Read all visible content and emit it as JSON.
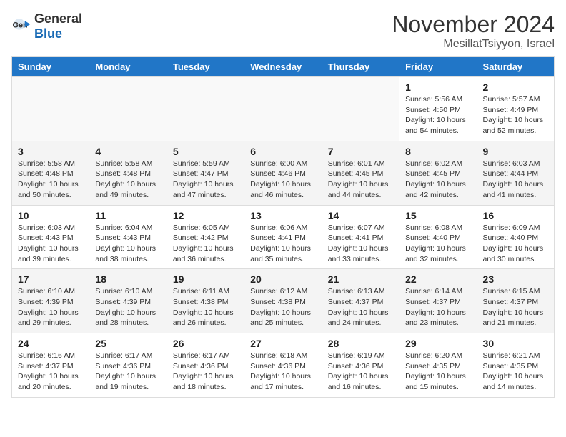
{
  "header": {
    "logo_general": "General",
    "logo_blue": "Blue",
    "month_year": "November 2024",
    "location": "MesillatTsiyyon, Israel"
  },
  "weekdays": [
    "Sunday",
    "Monday",
    "Tuesday",
    "Wednesday",
    "Thursday",
    "Friday",
    "Saturday"
  ],
  "weeks": [
    [
      {
        "day": "",
        "info": ""
      },
      {
        "day": "",
        "info": ""
      },
      {
        "day": "",
        "info": ""
      },
      {
        "day": "",
        "info": ""
      },
      {
        "day": "",
        "info": ""
      },
      {
        "day": "1",
        "info": "Sunrise: 5:56 AM\nSunset: 4:50 PM\nDaylight: 10 hours and 54 minutes."
      },
      {
        "day": "2",
        "info": "Sunrise: 5:57 AM\nSunset: 4:49 PM\nDaylight: 10 hours and 52 minutes."
      }
    ],
    [
      {
        "day": "3",
        "info": "Sunrise: 5:58 AM\nSunset: 4:48 PM\nDaylight: 10 hours and 50 minutes."
      },
      {
        "day": "4",
        "info": "Sunrise: 5:58 AM\nSunset: 4:48 PM\nDaylight: 10 hours and 49 minutes."
      },
      {
        "day": "5",
        "info": "Sunrise: 5:59 AM\nSunset: 4:47 PM\nDaylight: 10 hours and 47 minutes."
      },
      {
        "day": "6",
        "info": "Sunrise: 6:00 AM\nSunset: 4:46 PM\nDaylight: 10 hours and 46 minutes."
      },
      {
        "day": "7",
        "info": "Sunrise: 6:01 AM\nSunset: 4:45 PM\nDaylight: 10 hours and 44 minutes."
      },
      {
        "day": "8",
        "info": "Sunrise: 6:02 AM\nSunset: 4:45 PM\nDaylight: 10 hours and 42 minutes."
      },
      {
        "day": "9",
        "info": "Sunrise: 6:03 AM\nSunset: 4:44 PM\nDaylight: 10 hours and 41 minutes."
      }
    ],
    [
      {
        "day": "10",
        "info": "Sunrise: 6:03 AM\nSunset: 4:43 PM\nDaylight: 10 hours and 39 minutes."
      },
      {
        "day": "11",
        "info": "Sunrise: 6:04 AM\nSunset: 4:43 PM\nDaylight: 10 hours and 38 minutes."
      },
      {
        "day": "12",
        "info": "Sunrise: 6:05 AM\nSunset: 4:42 PM\nDaylight: 10 hours and 36 minutes."
      },
      {
        "day": "13",
        "info": "Sunrise: 6:06 AM\nSunset: 4:41 PM\nDaylight: 10 hours and 35 minutes."
      },
      {
        "day": "14",
        "info": "Sunrise: 6:07 AM\nSunset: 4:41 PM\nDaylight: 10 hours and 33 minutes."
      },
      {
        "day": "15",
        "info": "Sunrise: 6:08 AM\nSunset: 4:40 PM\nDaylight: 10 hours and 32 minutes."
      },
      {
        "day": "16",
        "info": "Sunrise: 6:09 AM\nSunset: 4:40 PM\nDaylight: 10 hours and 30 minutes."
      }
    ],
    [
      {
        "day": "17",
        "info": "Sunrise: 6:10 AM\nSunset: 4:39 PM\nDaylight: 10 hours and 29 minutes."
      },
      {
        "day": "18",
        "info": "Sunrise: 6:10 AM\nSunset: 4:39 PM\nDaylight: 10 hours and 28 minutes."
      },
      {
        "day": "19",
        "info": "Sunrise: 6:11 AM\nSunset: 4:38 PM\nDaylight: 10 hours and 26 minutes."
      },
      {
        "day": "20",
        "info": "Sunrise: 6:12 AM\nSunset: 4:38 PM\nDaylight: 10 hours and 25 minutes."
      },
      {
        "day": "21",
        "info": "Sunrise: 6:13 AM\nSunset: 4:37 PM\nDaylight: 10 hours and 24 minutes."
      },
      {
        "day": "22",
        "info": "Sunrise: 6:14 AM\nSunset: 4:37 PM\nDaylight: 10 hours and 23 minutes."
      },
      {
        "day": "23",
        "info": "Sunrise: 6:15 AM\nSunset: 4:37 PM\nDaylight: 10 hours and 21 minutes."
      }
    ],
    [
      {
        "day": "24",
        "info": "Sunrise: 6:16 AM\nSunset: 4:37 PM\nDaylight: 10 hours and 20 minutes."
      },
      {
        "day": "25",
        "info": "Sunrise: 6:17 AM\nSunset: 4:36 PM\nDaylight: 10 hours and 19 minutes."
      },
      {
        "day": "26",
        "info": "Sunrise: 6:17 AM\nSunset: 4:36 PM\nDaylight: 10 hours and 18 minutes."
      },
      {
        "day": "27",
        "info": "Sunrise: 6:18 AM\nSunset: 4:36 PM\nDaylight: 10 hours and 17 minutes."
      },
      {
        "day": "28",
        "info": "Sunrise: 6:19 AM\nSunset: 4:36 PM\nDaylight: 10 hours and 16 minutes."
      },
      {
        "day": "29",
        "info": "Sunrise: 6:20 AM\nSunset: 4:35 PM\nDaylight: 10 hours and 15 minutes."
      },
      {
        "day": "30",
        "info": "Sunrise: 6:21 AM\nSunset: 4:35 PM\nDaylight: 10 hours and 14 minutes."
      }
    ]
  ]
}
